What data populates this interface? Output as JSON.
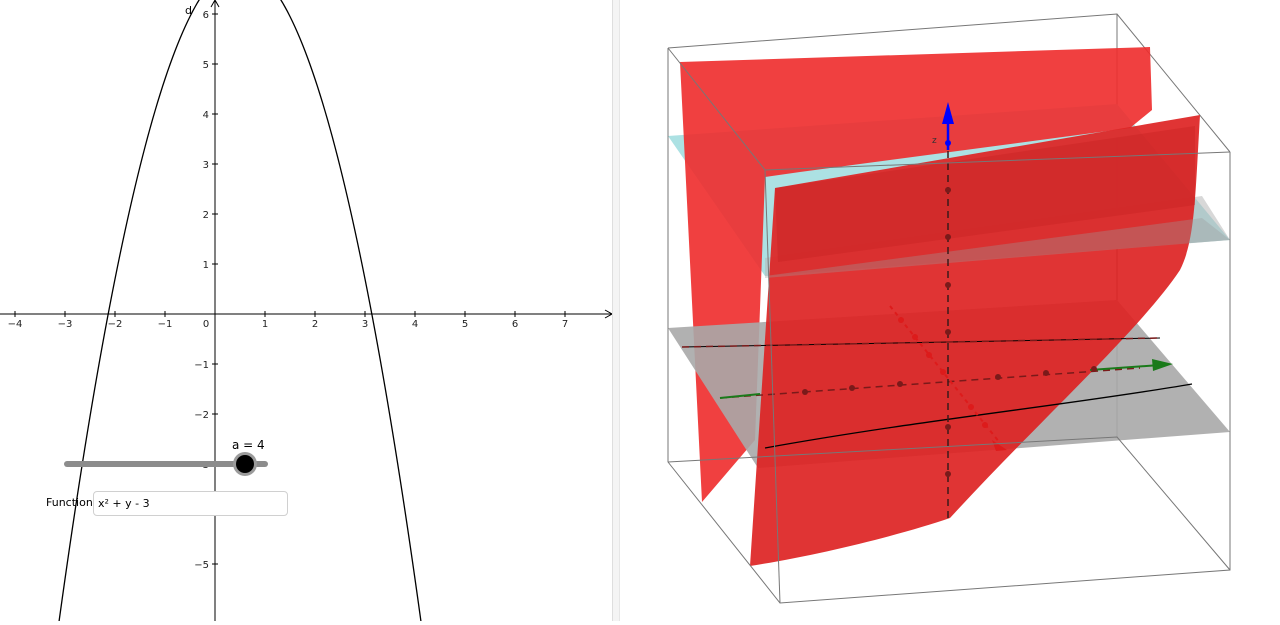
{
  "graphics_2d": {
    "axis_label_y": "d",
    "x_ticks": [
      "−4",
      "−3",
      "−2",
      "−1",
      "0",
      "1",
      "2",
      "3",
      "4",
      "5",
      "6",
      "7"
    ],
    "y_ticks": [
      "6",
      "5",
      "4",
      "3",
      "2",
      "1",
      "−1",
      "−2",
      "−3",
      "−5"
    ],
    "curve_color": "#000000"
  },
  "slider": {
    "label": "a = 4",
    "value": 4
  },
  "input_box": {
    "label": "Function",
    "value": "x² + y - 3"
  },
  "graphics_3d": {
    "surface_color": "#ee2b2b",
    "plane_colors": [
      "#a8dfe2",
      "#a9a9a9"
    ],
    "axis_colors": {
      "x": "#cc1f1f",
      "y": "#1a7a1a",
      "z": "#0000ff"
    },
    "axis_label_z": "z"
  }
}
